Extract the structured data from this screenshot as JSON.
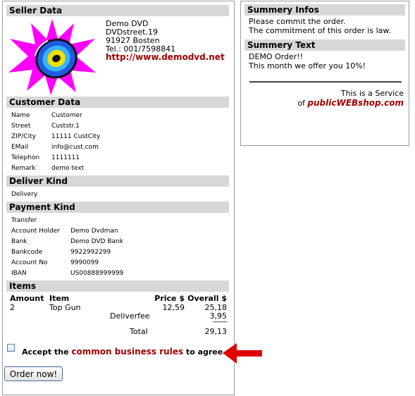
{
  "seller": {
    "header": "Seller Data",
    "lines": [
      "Demo DVD",
      "DVDstreet.19",
      "91927 Bosten",
      "Tel.: 001/7598841"
    ],
    "url": "http://www.demodvd.net"
  },
  "customer": {
    "header": "Customer Data",
    "rows": [
      {
        "label": "Name",
        "value": "Customer"
      },
      {
        "label": "Street",
        "value": "Custstr.1"
      },
      {
        "label": "ZIP/City",
        "value": "11111 CustCity"
      },
      {
        "label": "EMail",
        "value": "info@cust.com"
      },
      {
        "label": "Telephon",
        "value": "1111111"
      },
      {
        "label": "Remark",
        "value": "demo text"
      }
    ]
  },
  "delivery": {
    "header": "Deliver Kind",
    "value": "Delivery"
  },
  "payment": {
    "header": "Payment Kind",
    "kind": "Transfer",
    "rows": [
      {
        "label": "Account Holder",
        "value": "Demo Dvdman"
      },
      {
        "label": "Bank",
        "value": "Demo DVD Bank"
      },
      {
        "label": "Bankcode",
        "value": "9922992299"
      },
      {
        "label": "Account No",
        "value": "9990099"
      },
      {
        "label": "IBAN",
        "value": "US00888999999"
      }
    ]
  },
  "items": {
    "header": "Items",
    "col_amount": "Amount",
    "col_item": "Item",
    "col_price": "Price $",
    "col_overall": "Overall $",
    "rows": [
      {
        "amount": "2",
        "item": "Top Gun",
        "price": "12,59",
        "overall": "25,18"
      }
    ],
    "deliverfee_label": "Deliverfee",
    "deliverfee_value": "3,95",
    "separator": "---------",
    "total_label": "Total",
    "total_value": "29,13"
  },
  "agree": {
    "prefix": "Accept the",
    "link": "common business rules",
    "suffix": "to agree"
  },
  "order_button": "Order now!",
  "summary": {
    "header": "Summery Infos",
    "line1": "Please commit the order.",
    "line2": "The commitment of this order is law."
  },
  "summary_text": {
    "header": "Summery Text",
    "line1": "DEMO Order!!",
    "line2": "This month we offer you 10%!"
  },
  "service": {
    "line1": "This is a Service",
    "of": "of",
    "brand": "publicWEBshop.com"
  },
  "colors": {
    "accent": "#a00000",
    "bar": "#d7d7d7",
    "arrow": "#e00000",
    "logo_star": "#ff00ff"
  }
}
